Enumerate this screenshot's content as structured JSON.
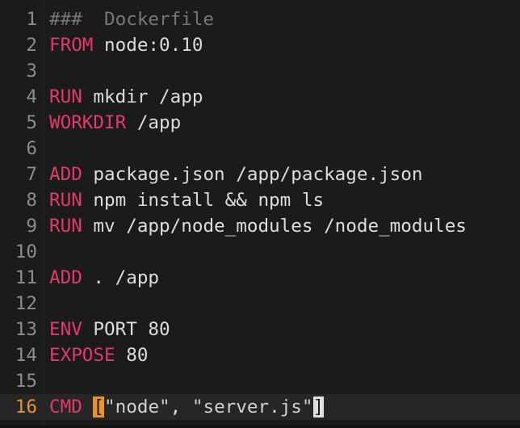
{
  "editor": {
    "file_name": "Dockerfile",
    "current_line": 16,
    "colors": {
      "background": "#1b1b1b",
      "keyword": "#e6386a",
      "comment": "#777777",
      "current_line_number": "#e8932e",
      "line_number": "#8c8c8c"
    },
    "lines": [
      {
        "num": "1",
        "tokens": [
          {
            "type": "comment",
            "text": "###  Dockerfile"
          }
        ]
      },
      {
        "num": "2",
        "tokens": [
          {
            "type": "keyword",
            "text": "FROM"
          },
          {
            "type": "text",
            "text": " node:0.10"
          }
        ]
      },
      {
        "num": "3",
        "tokens": []
      },
      {
        "num": "4",
        "tokens": [
          {
            "type": "keyword",
            "text": "RUN"
          },
          {
            "type": "text",
            "text": " mkdir /app"
          }
        ]
      },
      {
        "num": "5",
        "tokens": [
          {
            "type": "keyword",
            "text": "WORKDIR"
          },
          {
            "type": "text",
            "text": " /app"
          }
        ]
      },
      {
        "num": "6",
        "tokens": []
      },
      {
        "num": "7",
        "tokens": [
          {
            "type": "keyword",
            "text": "ADD"
          },
          {
            "type": "text",
            "text": " package.json /app/package.json"
          }
        ]
      },
      {
        "num": "8",
        "tokens": [
          {
            "type": "keyword",
            "text": "RUN"
          },
          {
            "type": "text",
            "text": " npm install && npm ls"
          }
        ]
      },
      {
        "num": "9",
        "tokens": [
          {
            "type": "keyword",
            "text": "RUN"
          },
          {
            "type": "text",
            "text": " mv /app/node_modules /node_modules"
          }
        ]
      },
      {
        "num": "10",
        "tokens": []
      },
      {
        "num": "11",
        "tokens": [
          {
            "type": "keyword",
            "text": "ADD"
          },
          {
            "type": "text",
            "text": " . /app"
          }
        ]
      },
      {
        "num": "12",
        "tokens": []
      },
      {
        "num": "13",
        "tokens": [
          {
            "type": "keyword",
            "text": "ENV"
          },
          {
            "type": "text",
            "text": " PORT 80"
          }
        ]
      },
      {
        "num": "14",
        "tokens": [
          {
            "type": "keyword",
            "text": "EXPOSE"
          },
          {
            "type": "text",
            "text": " 80"
          }
        ]
      },
      {
        "num": "15",
        "tokens": []
      },
      {
        "num": "16",
        "tokens": [
          {
            "type": "keyword",
            "text": "CMD"
          },
          {
            "type": "text",
            "text": " "
          },
          {
            "type": "bracket-open",
            "text": "["
          },
          {
            "type": "string",
            "text": "\"node\""
          },
          {
            "type": "text",
            "text": ", "
          },
          {
            "type": "string",
            "text": "\"server.js\""
          },
          {
            "type": "bracket-close",
            "text": "]"
          }
        ]
      }
    ]
  }
}
